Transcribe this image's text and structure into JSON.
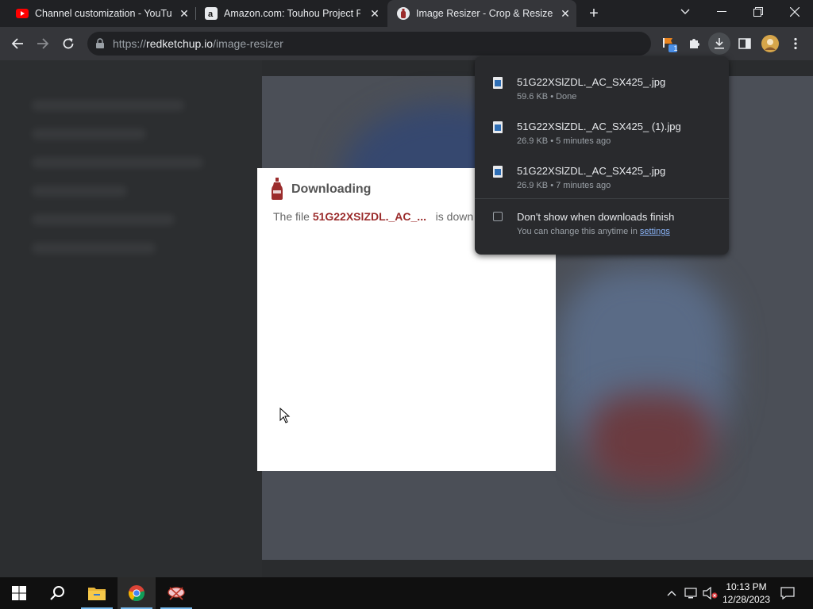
{
  "tabs": [
    {
      "title": "Channel customization - YouTube",
      "favicon": "youtube-icon",
      "active": false
    },
    {
      "title": "Amazon.com: Touhou Project Plush",
      "favicon": "amazon-icon",
      "active": false
    },
    {
      "title": "Image Resizer - Crop & Resize Images",
      "favicon": "redketchup-icon",
      "active": true
    }
  ],
  "address_bar": {
    "host": "redketchup.io",
    "prefix": "https://",
    "path": "/image-resizer"
  },
  "extensions": {
    "badge_count": "1"
  },
  "modal": {
    "title": "Downloading",
    "text_prefix": "The file ",
    "filename": "51G22XSlZDL._AC_...",
    "text_suffix": "is down"
  },
  "downloads": {
    "items": [
      {
        "name": "51G22XSlZDL._AC_SX425_.jpg",
        "status": "59.6 KB • Done"
      },
      {
        "name": "51G22XSlZDL._AC_SX425_ (1).jpg",
        "status": "26.9 KB • 5 minutes ago"
      },
      {
        "name": "51G22XSlZDL._AC_SX425_.jpg",
        "status": "26.9 KB • 7 minutes ago"
      }
    ],
    "dont_show_label": "Don't show when downloads finish",
    "hint_prefix": "You can change this anytime in ",
    "hint_link": "settings"
  },
  "taskbar": {
    "time": "10:13 PM",
    "date": "12/28/2023"
  },
  "colors": {
    "accent": "#9b2c2c",
    "link": "#8ab4f8",
    "taskbar_running": "#76b9ed"
  }
}
